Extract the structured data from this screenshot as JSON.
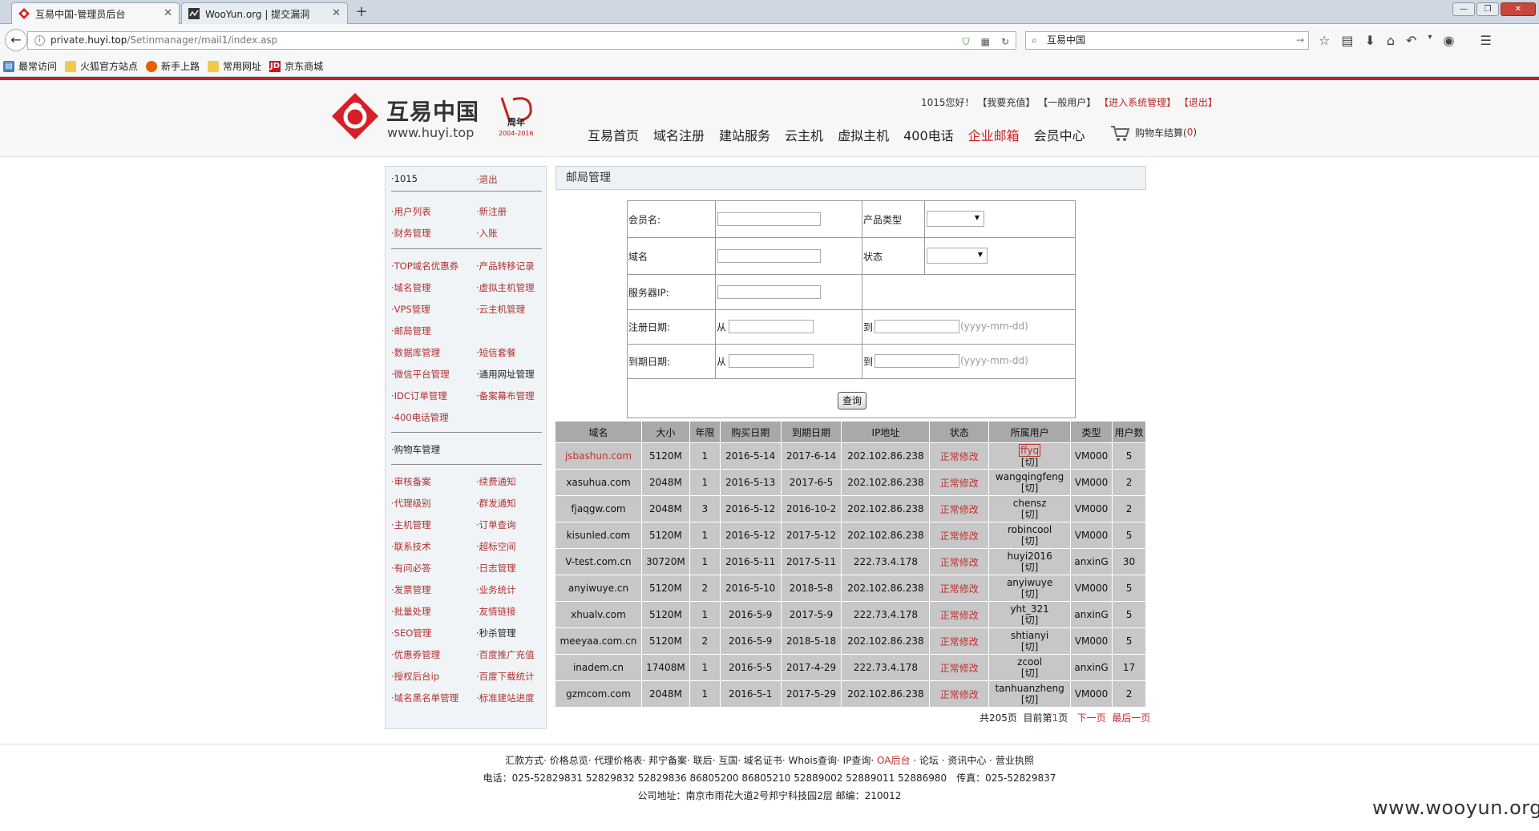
{
  "browser": {
    "tabs": [
      {
        "title": "互易中国-管理员后台",
        "active": true
      },
      {
        "title": "WooYun.org | 提交漏洞",
        "active": false
      }
    ],
    "new_tab": "+",
    "url": {
      "prefix": "private.",
      "host": "huyi.top",
      "path": "/Setinmanager/mail1/index.asp"
    },
    "search_value": "互易中国",
    "bookmarks": [
      "最常访问",
      "火狐官方站点",
      "新手上路",
      "常用网址",
      "京东商城"
    ],
    "icons": [
      "back-arrow-icon",
      "info-icon",
      "shield-icon",
      "qr-icon",
      "reload-icon",
      "search-icon",
      "star-icon",
      "reader-icon",
      "download-icon",
      "home-icon",
      "undo-icon",
      "menu-icon"
    ]
  },
  "header": {
    "logo_text": "互易中国",
    "logo_url": "www.huyi.top",
    "anniv_text": "周年",
    "anniv_years": "2004-2016",
    "greeting": "1015您好！",
    "links": [
      "【我要充值】",
      "【一般用户】",
      "【进入系统管理】",
      "【退出】"
    ],
    "nav": [
      "互易首页",
      "域名注册",
      "建站服务",
      "云主机",
      "虚拟主机",
      "400电话",
      "企业邮箱",
      "会员中心"
    ],
    "active_nav": "企业邮箱",
    "cart_label": "购物车结算(",
    "cart_count": " 0 ",
    "cart_close": ")"
  },
  "sidebar": {
    "rows": [
      [
        "·1015",
        "·退出"
      ],
      [
        "·用户列表",
        "·新注册"
      ],
      [
        "·财务管理",
        "·入账"
      ],
      [
        "·TOP域名优惠券",
        "·产品转移记录"
      ],
      [
        "·域名管理",
        "·虚拟主机管理"
      ],
      [
        "·VPS管理",
        "·云主机管理"
      ],
      [
        "·邮局管理",
        ""
      ],
      [
        "·数据库管理",
        "·短信套餐"
      ],
      [
        "·微信平台管理",
        "·通用网址管理"
      ],
      [
        "·IDC订单管理",
        "·备案幕布管理"
      ],
      [
        "·400电话管理",
        ""
      ],
      [
        "·购物车管理",
        ""
      ],
      [
        "·审核备案",
        "·续费通知"
      ],
      [
        "·代理级别",
        "·群发通知"
      ],
      [
        "·主机管理",
        "·订单查询"
      ],
      [
        "·联系技术",
        "·超标空间"
      ],
      [
        "·有问必答",
        "·日志管理"
      ],
      [
        "·发票管理",
        "·业务统计"
      ],
      [
        "·批量处理",
        "·友情链接"
      ],
      [
        "·SEO管理",
        "·秒杀管理"
      ],
      [
        "·优惠券管理",
        "·百度推广充值"
      ],
      [
        "·授权后台ip",
        "·百度下载统计"
      ],
      [
        "·域名黑名单管理",
        "·标准建站进度"
      ]
    ]
  },
  "main": {
    "title": "邮局管理",
    "form": {
      "member_label": "会员名:",
      "product_type_label": "产品类型",
      "domain_label": "域名",
      "status_label": "状态",
      "server_ip_label": "服务器IP:",
      "reg_date_label": "注册日期:",
      "exp_date_label": "到期日期:",
      "from": "从",
      "to": "到",
      "date_hint": "(yyyy-mm-dd)",
      "query_button": "查询"
    },
    "table": {
      "columns": [
        "域名",
        "大小",
        "年限",
        "购买日期",
        "到期日期",
        "IP地址",
        "状态",
        "所属用户",
        "类型",
        "用户数"
      ],
      "switch_label": "[切]",
      "rows": [
        [
          "jsbashun.com",
          "5120M",
          "1",
          "2016-5-14",
          "2017-6-14",
          "202.102.86.238",
          "正常修改",
          "ffyq",
          "VM000",
          "5"
        ],
        [
          "xasuhua.com",
          "2048M",
          "1",
          "2016-5-13",
          "2017-6-5",
          "202.102.86.238",
          "正常修改",
          "wangqingfeng",
          "VM000",
          "2"
        ],
        [
          "fjaqgw.com",
          "2048M",
          "3",
          "2016-5-12",
          "2016-10-2",
          "202.102.86.238",
          "正常修改",
          "chensz",
          "VM000",
          "2"
        ],
        [
          "kisunled.com",
          "5120M",
          "1",
          "2016-5-12",
          "2017-5-12",
          "202.102.86.238",
          "正常修改",
          "robincool",
          "VM000",
          "5"
        ],
        [
          "V-test.com.cn",
          "30720M",
          "1",
          "2016-5-11",
          "2017-5-11",
          "222.73.4.178",
          "正常修改",
          "huyi2016",
          "anxinG",
          "30"
        ],
        [
          "anyiwuye.cn",
          "5120M",
          "2",
          "2016-5-10",
          "2018-5-8",
          "202.102.86.238",
          "正常修改",
          "anyiwuye",
          "VM000",
          "5"
        ],
        [
          "xhualv.com",
          "5120M",
          "1",
          "2016-5-9",
          "2017-5-9",
          "222.73.4.178",
          "正常修改",
          "yht_321",
          "anxinG",
          "5"
        ],
        [
          "meeyaa.com.cn",
          "5120M",
          "2",
          "2016-5-9",
          "2018-5-18",
          "202.102.86.238",
          "正常修改",
          "shtianyi",
          "VM000",
          "5"
        ],
        [
          "inadem.cn",
          "17408M",
          "1",
          "2016-5-5",
          "2017-4-29",
          "222.73.4.178",
          "正常修改",
          "zcool",
          "anxinG",
          "17"
        ],
        [
          "gzmcom.com",
          "2048M",
          "1",
          "2016-5-1",
          "2017-5-29",
          "202.102.86.238",
          "正常修改",
          "tanhuanzheng",
          "VM000",
          "2"
        ]
      ]
    },
    "pager": {
      "total": "共205页",
      "current_prefix": "目前第",
      "current": "1",
      "current_suffix": "页",
      "next": "下一页",
      "last": "最后一页"
    }
  },
  "footer": {
    "links_line": "汇款方式· 价格总览· 代理价格表· 邦宁备案· 联后· 互国· 域名证书· Whois查询· IP查询·",
    "oa": "OA后台",
    "links_line_end": "· 论坛 · 资讯中心 · 营业执照",
    "phone_line": "电话：025-52829831 52829832 52829836 86805200 86805210 52889002 52889011 52886980　传真：025-52829837",
    "address_line": "公司地址：南京市雨花大道2号邦宁科技园2层 邮编：210012"
  },
  "watermark": "www.wooyun.org",
  "colors": {
    "accent_red": "#cc1f1f",
    "link_red": "#b03030",
    "table_header": "#a9a9a9",
    "table_cell": "#c7c7c7"
  }
}
